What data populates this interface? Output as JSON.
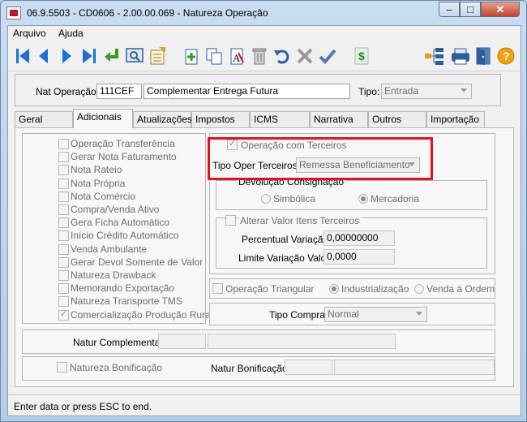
{
  "window": {
    "title": "06.9.5503 - CD0606 - 2.00.00.069 - Natureza Operação",
    "minimize": "–",
    "maximize": "□",
    "close": "✕"
  },
  "menu": {
    "items": [
      "Arquivo",
      "Ajuda"
    ]
  },
  "toolbar": {
    "buttons": [
      "first-icon",
      "previous-icon",
      "next-icon",
      "last-icon",
      "goto-icon",
      "search-icon",
      "list-icon",
      "new-icon",
      "copy-icon",
      "modify-icon",
      "delete-icon",
      "undo-icon",
      "cancel-icon",
      "save-icon",
      "currency-icon",
      "tree-icon",
      "print-icon",
      "exit-icon",
      "help-icon"
    ]
  },
  "header": {
    "nat_label": "Nat Operação:",
    "nat_code": "111CEF",
    "nat_desc": "Complementar Entrega Futura",
    "tipo_label": "Tipo:",
    "tipo_value": "Entrada"
  },
  "tabs": [
    "Geral",
    "Adicionais",
    "Atualizações",
    "Impostos",
    "ICMS",
    "Narrativa",
    "Outros",
    "Importação"
  ],
  "active_tab": "Adicionais",
  "left_checks": [
    {
      "label": "Operação Transferência",
      "checked": false
    },
    {
      "label": "Gerar Nota Faturamento",
      "checked": false
    },
    {
      "label": "Nota Rateio",
      "checked": false
    },
    {
      "label": "Nota Própria",
      "checked": false
    },
    {
      "label": "Nota Comércio",
      "checked": false
    },
    {
      "label": "Compra/Venda Ativo",
      "checked": false
    },
    {
      "label": "Gera Ficha Automático",
      "checked": false
    },
    {
      "label": "Início Crédito Automático",
      "checked": false
    },
    {
      "label": "Venda Ambulante",
      "checked": false
    },
    {
      "label": "Gerar Devol Somente de Valor",
      "checked": false
    },
    {
      "label": "Natureza Drawback",
      "checked": false
    },
    {
      "label": "Memorando Exportação",
      "checked": false
    },
    {
      "label": "Natureza Transporte TMS",
      "checked": false
    },
    {
      "label": "Comercialização Produção Rural",
      "checked": true
    }
  ],
  "terceiros": {
    "check_label": "Operação com Terceiros",
    "tipo_label": "Tipo Oper Terceiros:",
    "tipo_value": "Remessa Beneficiamento"
  },
  "devolucao": {
    "title": "Devolução Consignação",
    "opt1": "Simbólica",
    "opt2": "Mercadoria"
  },
  "alterar": {
    "check_label": "Alterar Valor Itens Terceiros",
    "perc_label": "Percentual Variação:",
    "perc_value": "0,00000000",
    "limite_label": "Limite Variação Valor:",
    "limite_value": "0,0000"
  },
  "triangular": {
    "check_label": "Operação Triangular",
    "opt1": "Industrialização",
    "opt2": "Venda à Ordem"
  },
  "compra": {
    "label": "Tipo Compra:",
    "value": "Normal"
  },
  "complementar": {
    "label": "Natur Complementar:"
  },
  "bonificacao": {
    "check_label": "Natureza Bonificação",
    "label": "Natur Bonificação:"
  },
  "status": {
    "text": "Enter data or press ESC to end."
  },
  "colors": {
    "highlight": "#e3111e",
    "nav_blue": "#1e6fd0"
  }
}
